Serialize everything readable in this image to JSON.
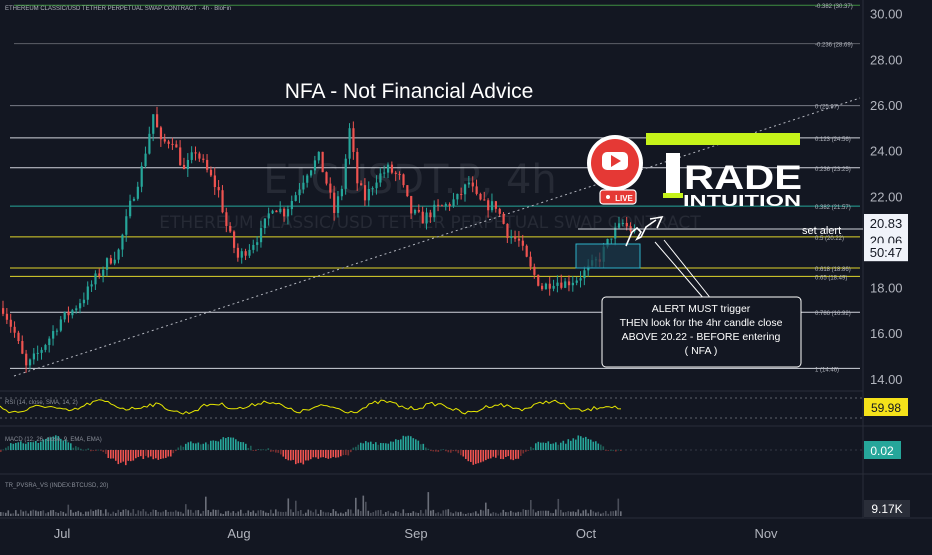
{
  "chart_data": {
    "type": "candlestick",
    "header": "ETHEREUM CLASSIC/USD TETHER PERPETUAL SWAP CONTRACT · 4h · BloFin",
    "annotation_title": "NFA - Not Financial Advice",
    "watermark": {
      "symbol": "ETCUSDT.P, 4h",
      "description": "ETHEREUM CLASSIC/USD TETHER PERPETUAL SWAP CONTRACT"
    },
    "y_axis": {
      "min": 13.6,
      "max": 30.6,
      "ticks": [
        "30.00",
        "28.00",
        "26.00",
        "24.00",
        "22.00",
        "20.00",
        "18.00",
        "16.00",
        "14.00"
      ]
    },
    "x_axis": {
      "ticks": [
        "Jul",
        "Aug",
        "Sep",
        "Oct",
        "Nov"
      ]
    },
    "price_path": [
      [
        0,
        17.1
      ],
      [
        3,
        16.0
      ],
      [
        6,
        14.5
      ],
      [
        9,
        15.1
      ],
      [
        12,
        15.8
      ],
      [
        15,
        16.6
      ],
      [
        18,
        17.0
      ],
      [
        21,
        17.6
      ],
      [
        24,
        18.4
      ],
      [
        27,
        19.1
      ],
      [
        30,
        19.6
      ],
      [
        33,
        21.6
      ],
      [
        36,
        23.2
      ],
      [
        39,
        25.6
      ],
      [
        41,
        24.3
      ],
      [
        44,
        24.5
      ],
      [
        47,
        23.1
      ],
      [
        50,
        24.0
      ],
      [
        53,
        23.1
      ],
      [
        56,
        22.2
      ],
      [
        58,
        20.7
      ],
      [
        61,
        19.3
      ],
      [
        64,
        19.8
      ],
      [
        67,
        20.4
      ],
      [
        70,
        21.6
      ],
      [
        73,
        21.3
      ],
      [
        76,
        22.1
      ],
      [
        79,
        23.1
      ],
      [
        82,
        23.7
      ],
      [
        84,
        22.6
      ],
      [
        86,
        21.3
      ],
      [
        88,
        22.4
      ],
      [
        90,
        24.9
      ],
      [
        92,
        22.6
      ],
      [
        94,
        21.9
      ],
      [
        97,
        22.8
      ],
      [
        100,
        23.2
      ],
      [
        103,
        22.8
      ],
      [
        106,
        21.3
      ],
      [
        109,
        21.0
      ],
      [
        112,
        21.4
      ],
      [
        115,
        21.6
      ],
      [
        118,
        21.9
      ],
      [
        121,
        22.6
      ],
      [
        123,
        21.9
      ],
      [
        125,
        21.6
      ],
      [
        128,
        21.6
      ],
      [
        131,
        20.4
      ],
      [
        134,
        20.0
      ],
      [
        137,
        18.8
      ],
      [
        140,
        18.0
      ],
      [
        143,
        18.3
      ],
      [
        146,
        18.2
      ],
      [
        149,
        18.4
      ],
      [
        152,
        18.8
      ],
      [
        155,
        19.3
      ],
      [
        158,
        20.3
      ],
      [
        161,
        20.8
      ],
      [
        164,
        20.4
      ]
    ],
    "fib_levels": [
      {
        "label": "-0.382 (30.37)",
        "value": 30.37,
        "color": "#3e8e41"
      },
      {
        "label": "-0.236 (28.69)",
        "value": 28.69,
        "color": "#5d6068"
      },
      {
        "label": "0 (25.97)",
        "value": 25.97,
        "color": "#787b86"
      },
      {
        "label": "0.123 (24.56)",
        "value": 24.56,
        "color": "#d1d4dc"
      },
      {
        "label": "0.236 (23.25)",
        "value": 23.25,
        "color": "#d1d4dc"
      },
      {
        "label": "0.382 (21.57)",
        "value": 21.57,
        "color": "#26a69a"
      },
      {
        "label": "0.5 (20.22)",
        "value": 20.22,
        "color": "#e0d62b"
      },
      {
        "label": "0.618 (18.86)",
        "value": 18.86,
        "color": "#e0d62b"
      },
      {
        "label": "0.65 (18.49)",
        "value": 18.49,
        "color": "#e0d62b"
      },
      {
        "label": "0.786 (16.92)",
        "value": 16.92,
        "color": "#d1d4dc"
      },
      {
        "label": "1 (14.46)",
        "value": 14.46,
        "color": "#d1d4dc"
      }
    ],
    "alert_level": {
      "label": "set alert",
      "value": 20.83
    },
    "price_badges": [
      {
        "text": "20.83",
        "value": 20.83,
        "bg": "#f0f3fa",
        "fg": "#131722"
      },
      {
        "text": "20.06",
        "value": 20.06,
        "bg": "#f0f3fa",
        "fg": "#131722"
      },
      {
        "text": "50:47",
        "value": 19.55,
        "bg": "#f0f3fa",
        "fg": "#131722"
      }
    ],
    "callout": {
      "lines": [
        "ALERT MUST trigger",
        "THEN look for the 4hr candle close",
        "ABOVE  20.22 - BEFORE entering",
        "( NFA )"
      ]
    },
    "rsi": {
      "label": "RSI (14, close, SMA, 14, 2)",
      "value": "59.98"
    },
    "macd": {
      "label": "MACD (12, 26, close, 9, EMA, EMA)",
      "value": "0.02"
    },
    "volume": {
      "label": "TR_PVSRA_VS (INDEX:BTCUSD, 20)",
      "value": "9.17K"
    }
  },
  "logo": {
    "text_top": "RADE",
    "text_bottom": "INTUITION"
  },
  "live_badge": {
    "text": "LIVE"
  },
  "colors": {
    "background": "#131722",
    "up": "#26a69a",
    "down": "#ef5350",
    "neutral": "#8a8f99",
    "brand": "#c6f31a",
    "rsi_line": "#e6e600"
  }
}
